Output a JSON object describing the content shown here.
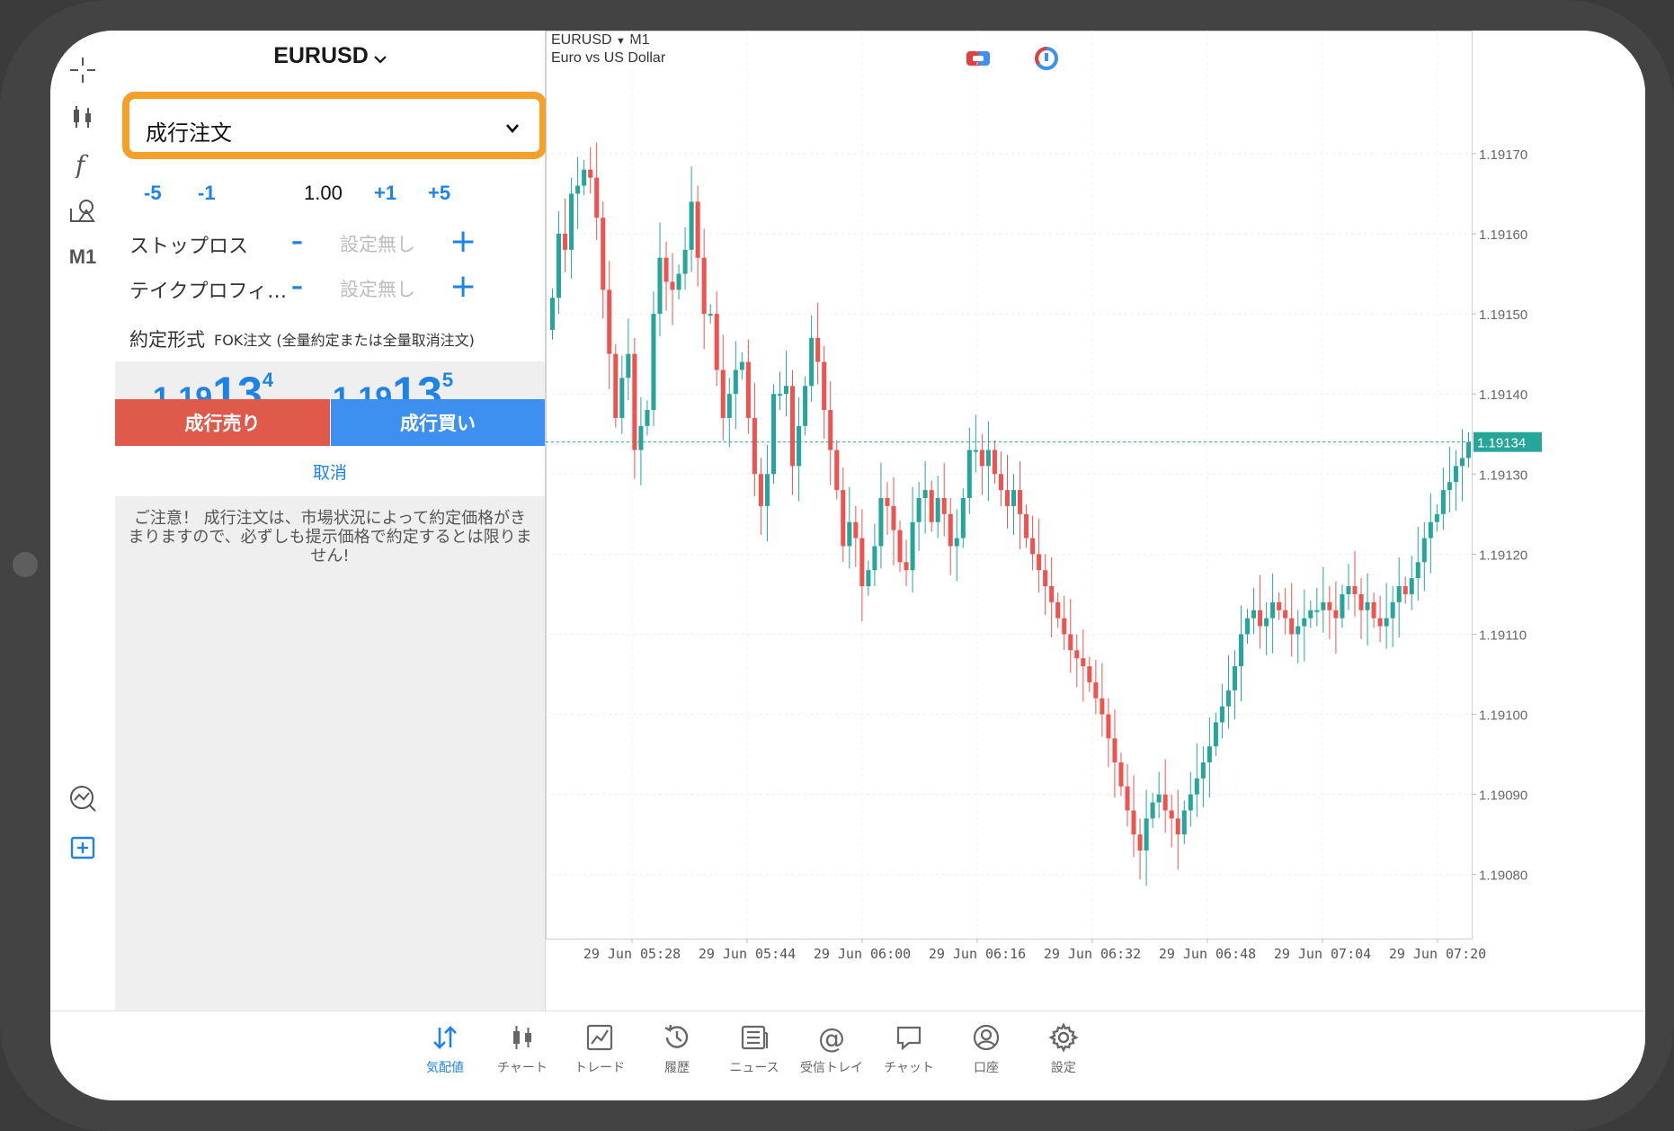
{
  "symbol": "EURUSD",
  "order_panel": {
    "order_type": "成行注文",
    "volume": {
      "m5": "-5",
      "m1": "-1",
      "value": "1.00",
      "p1": "+1",
      "p5": "+5"
    },
    "stop_loss": {
      "label": "ストップロス",
      "value": "設定無し"
    },
    "take_profit": {
      "label": "テイクプロフィ…",
      "value": "設定無し"
    },
    "fill_policy": {
      "label": "約定形式",
      "value": "FOK注文 (全量約定または全量取消注文)"
    },
    "bid": {
      "prefix": "1.19",
      "big": "13",
      "sup": "4"
    },
    "ask": {
      "prefix": "1.19",
      "big": "13",
      "sup": "5"
    },
    "sell_label": "成行売り",
    "buy_label": "成行買い",
    "cancel_label": "取消",
    "notice": "ご注意！ 成行注文は、市場状況によって約定価格がきまりますので、必ずしも提示価格で約定するとは限りません!"
  },
  "toolbar": {
    "timeframe": "M1"
  },
  "chart_header": {
    "symbol": "EURUSD",
    "timeframe": "M1",
    "description": "Euro vs US Dollar"
  },
  "chart_data": {
    "type": "candlestick",
    "current_price": "1.19134",
    "price_labels": [
      "1.19170",
      "1.19160",
      "1.19150",
      "1.19140",
      "1.19130",
      "1.19120",
      "1.19110",
      "1.19100",
      "1.19090",
      "1.19080"
    ],
    "price_values": [
      1.1917,
      1.1916,
      1.1915,
      1.1914,
      1.1913,
      1.1912,
      1.1911,
      1.191,
      1.1909,
      1.1908
    ],
    "ylim": [
      1.19072,
      1.19182
    ],
    "time_labels": [
      "29 Jun 05:28",
      "29 Jun 05:44",
      "29 Jun 06:00",
      "29 Jun 06:16",
      "29 Jun 06:32",
      "29 Jun 06:48",
      "29 Jun 07:04",
      "29 Jun 07:20"
    ],
    "up_color": "#26a69a",
    "down_color": "#ef5350",
    "close": [
      1.19152,
      1.1916,
      1.19158,
      1.19165,
      1.19166,
      1.19168,
      1.19167,
      1.19162,
      1.19153,
      1.19145,
      1.19137,
      1.19142,
      1.19145,
      1.19133,
      1.19136,
      1.19138,
      1.1915,
      1.19157,
      1.19154,
      1.19153,
      1.19155,
      1.19158,
      1.19164,
      1.19157,
      1.1915,
      1.1915,
      1.19143,
      1.19137,
      1.1914,
      1.19143,
      1.19144,
      1.19137,
      1.1913,
      1.19126,
      1.1913,
      1.1914,
      1.1914,
      1.19141,
      1.19131,
      1.19136,
      1.19141,
      1.19147,
      1.19144,
      1.19138,
      1.19133,
      1.19128,
      1.19121,
      1.19124,
      1.19122,
      1.19116,
      1.19118,
      1.19121,
      1.19127,
      1.19126,
      1.19123,
      1.19119,
      1.19118,
      1.19124,
      1.19127,
      1.19128,
      1.19124,
      1.19127,
      1.19125,
      1.19121,
      1.19122,
      1.19127,
      1.19133,
      1.19133,
      1.19131,
      1.19133,
      1.1913,
      1.19128,
      1.19126,
      1.19128,
      1.19125,
      1.19122,
      1.1912,
      1.19118,
      1.19116,
      1.19114,
      1.19112,
      1.1911,
      1.19108,
      1.19107,
      1.19106,
      1.19104,
      1.19102,
      1.191,
      1.19097,
      1.19094,
      1.19091,
      1.19088,
      1.19085,
      1.19083,
      1.19087,
      1.19089,
      1.1909,
      1.19088,
      1.19087,
      1.19085,
      1.19088,
      1.1909,
      1.19092,
      1.19094,
      1.19096,
      1.19099,
      1.19101,
      1.19103,
      1.19106,
      1.1911,
      1.19112,
      1.19113,
      1.19111,
      1.19112,
      1.19114,
      1.19113,
      1.19112,
      1.1911,
      1.19111,
      1.19112,
      1.19113,
      1.19113,
      1.19114,
      1.19113,
      1.19112,
      1.19115,
      1.19116,
      1.19115,
      1.19113,
      1.19114,
      1.19112,
      1.19111,
      1.19112,
      1.19114,
      1.19116,
      1.19115,
      1.19117,
      1.19119,
      1.19122,
      1.19124,
      1.19125,
      1.19128,
      1.19129,
      1.19131,
      1.19132,
      1.19134
    ]
  },
  "nav": {
    "items": [
      {
        "label": "気配値"
      },
      {
        "label": "チャート"
      },
      {
        "label": "トレード"
      },
      {
        "label": "履歴"
      },
      {
        "label": "ニュース"
      },
      {
        "label": "受信トレイ"
      },
      {
        "label": "チャット"
      },
      {
        "label": "口座"
      },
      {
        "label": "設定"
      }
    ]
  }
}
